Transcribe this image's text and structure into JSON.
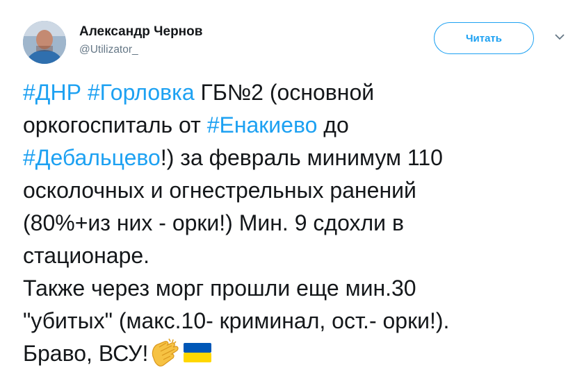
{
  "author": {
    "name": "Александр Чернов",
    "handle": "@Utilizator_"
  },
  "follow_button": {
    "label": "Читать"
  },
  "menu": {
    "icon": "chevron-down-icon"
  },
  "tweet": {
    "lines": [
      [
        {
          "t": "#ДНР",
          "tag": true
        },
        {
          "t": " "
        },
        {
          "t": "#Горловка",
          "tag": true
        },
        {
          "t": " ГБ№2 (основной"
        }
      ],
      [
        {
          "t": "оркогоспиталь от "
        },
        {
          "t": "#Енакиево",
          "tag": true
        },
        {
          "t": " до"
        }
      ],
      [
        {
          "t": "#Дебальцево",
          "tag": true
        },
        {
          "t": "!) за февраль минимум 110"
        }
      ],
      [
        {
          "t": "осколочных и огнестрельных ранений"
        }
      ],
      [
        {
          "t": "(80%+из них - орки!) Мин. 9 сдохли в"
        }
      ],
      [
        {
          "t": "стационаре."
        }
      ],
      [
        {
          "t": "Также через морг прошли еще мин.30"
        }
      ],
      [
        {
          "t": "\"убитых\" (макс.10- криминал, ост.- орки!)."
        }
      ],
      [
        {
          "t": "Браво, ВСУ!"
        }
      ]
    ],
    "trailing_emojis": [
      "clapping-hands-icon",
      "ukraine-flag-icon"
    ]
  },
  "colors": {
    "link": "#1da1f2",
    "text": "#14171a",
    "secondary": "#657786",
    "flag_blue": "#0057b7",
    "flag_yellow": "#ffd700"
  }
}
